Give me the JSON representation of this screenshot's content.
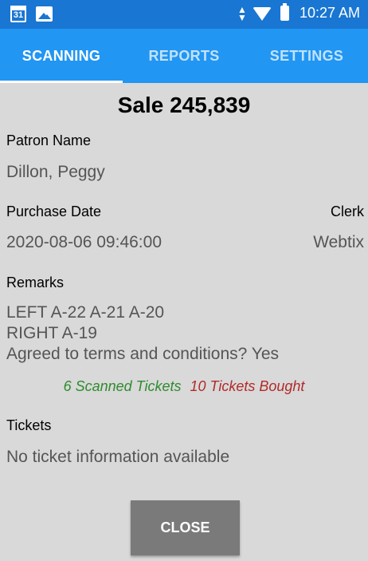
{
  "status_bar": {
    "calendar_day": "31",
    "time": "10:27 AM"
  },
  "tabs": [
    {
      "label": "SCANNING",
      "active": true
    },
    {
      "label": "REPORTS",
      "active": false
    },
    {
      "label": "SETTINGS",
      "active": false
    }
  ],
  "sale": {
    "title": "Sale 245,839"
  },
  "patron": {
    "label": "Patron Name",
    "value": "Dillon, Peggy"
  },
  "purchase": {
    "date_label": "Purchase Date",
    "date_value": "2020-08-06 09:46:00",
    "clerk_label": "Clerk",
    "clerk_value": "Webtix"
  },
  "remarks": {
    "label": "Remarks",
    "lines": [
      "LEFT A-22 A-21 A-20",
      "RIGHT A-19",
      "Agreed to terms and conditions? Yes"
    ]
  },
  "counts": {
    "scanned": "6 Scanned Tickets",
    "bought": "10 Tickets Bought"
  },
  "tickets": {
    "label": "Tickets",
    "value": "No ticket information available"
  },
  "close_button": "CLOSE",
  "colors": {
    "status_bar": "#1976d2",
    "tab_bar": "#2196f3",
    "background": "#d9d9d9",
    "scanned": "#2e8b2e",
    "bought": "#b22a2a",
    "button": "#7a7a7a"
  }
}
